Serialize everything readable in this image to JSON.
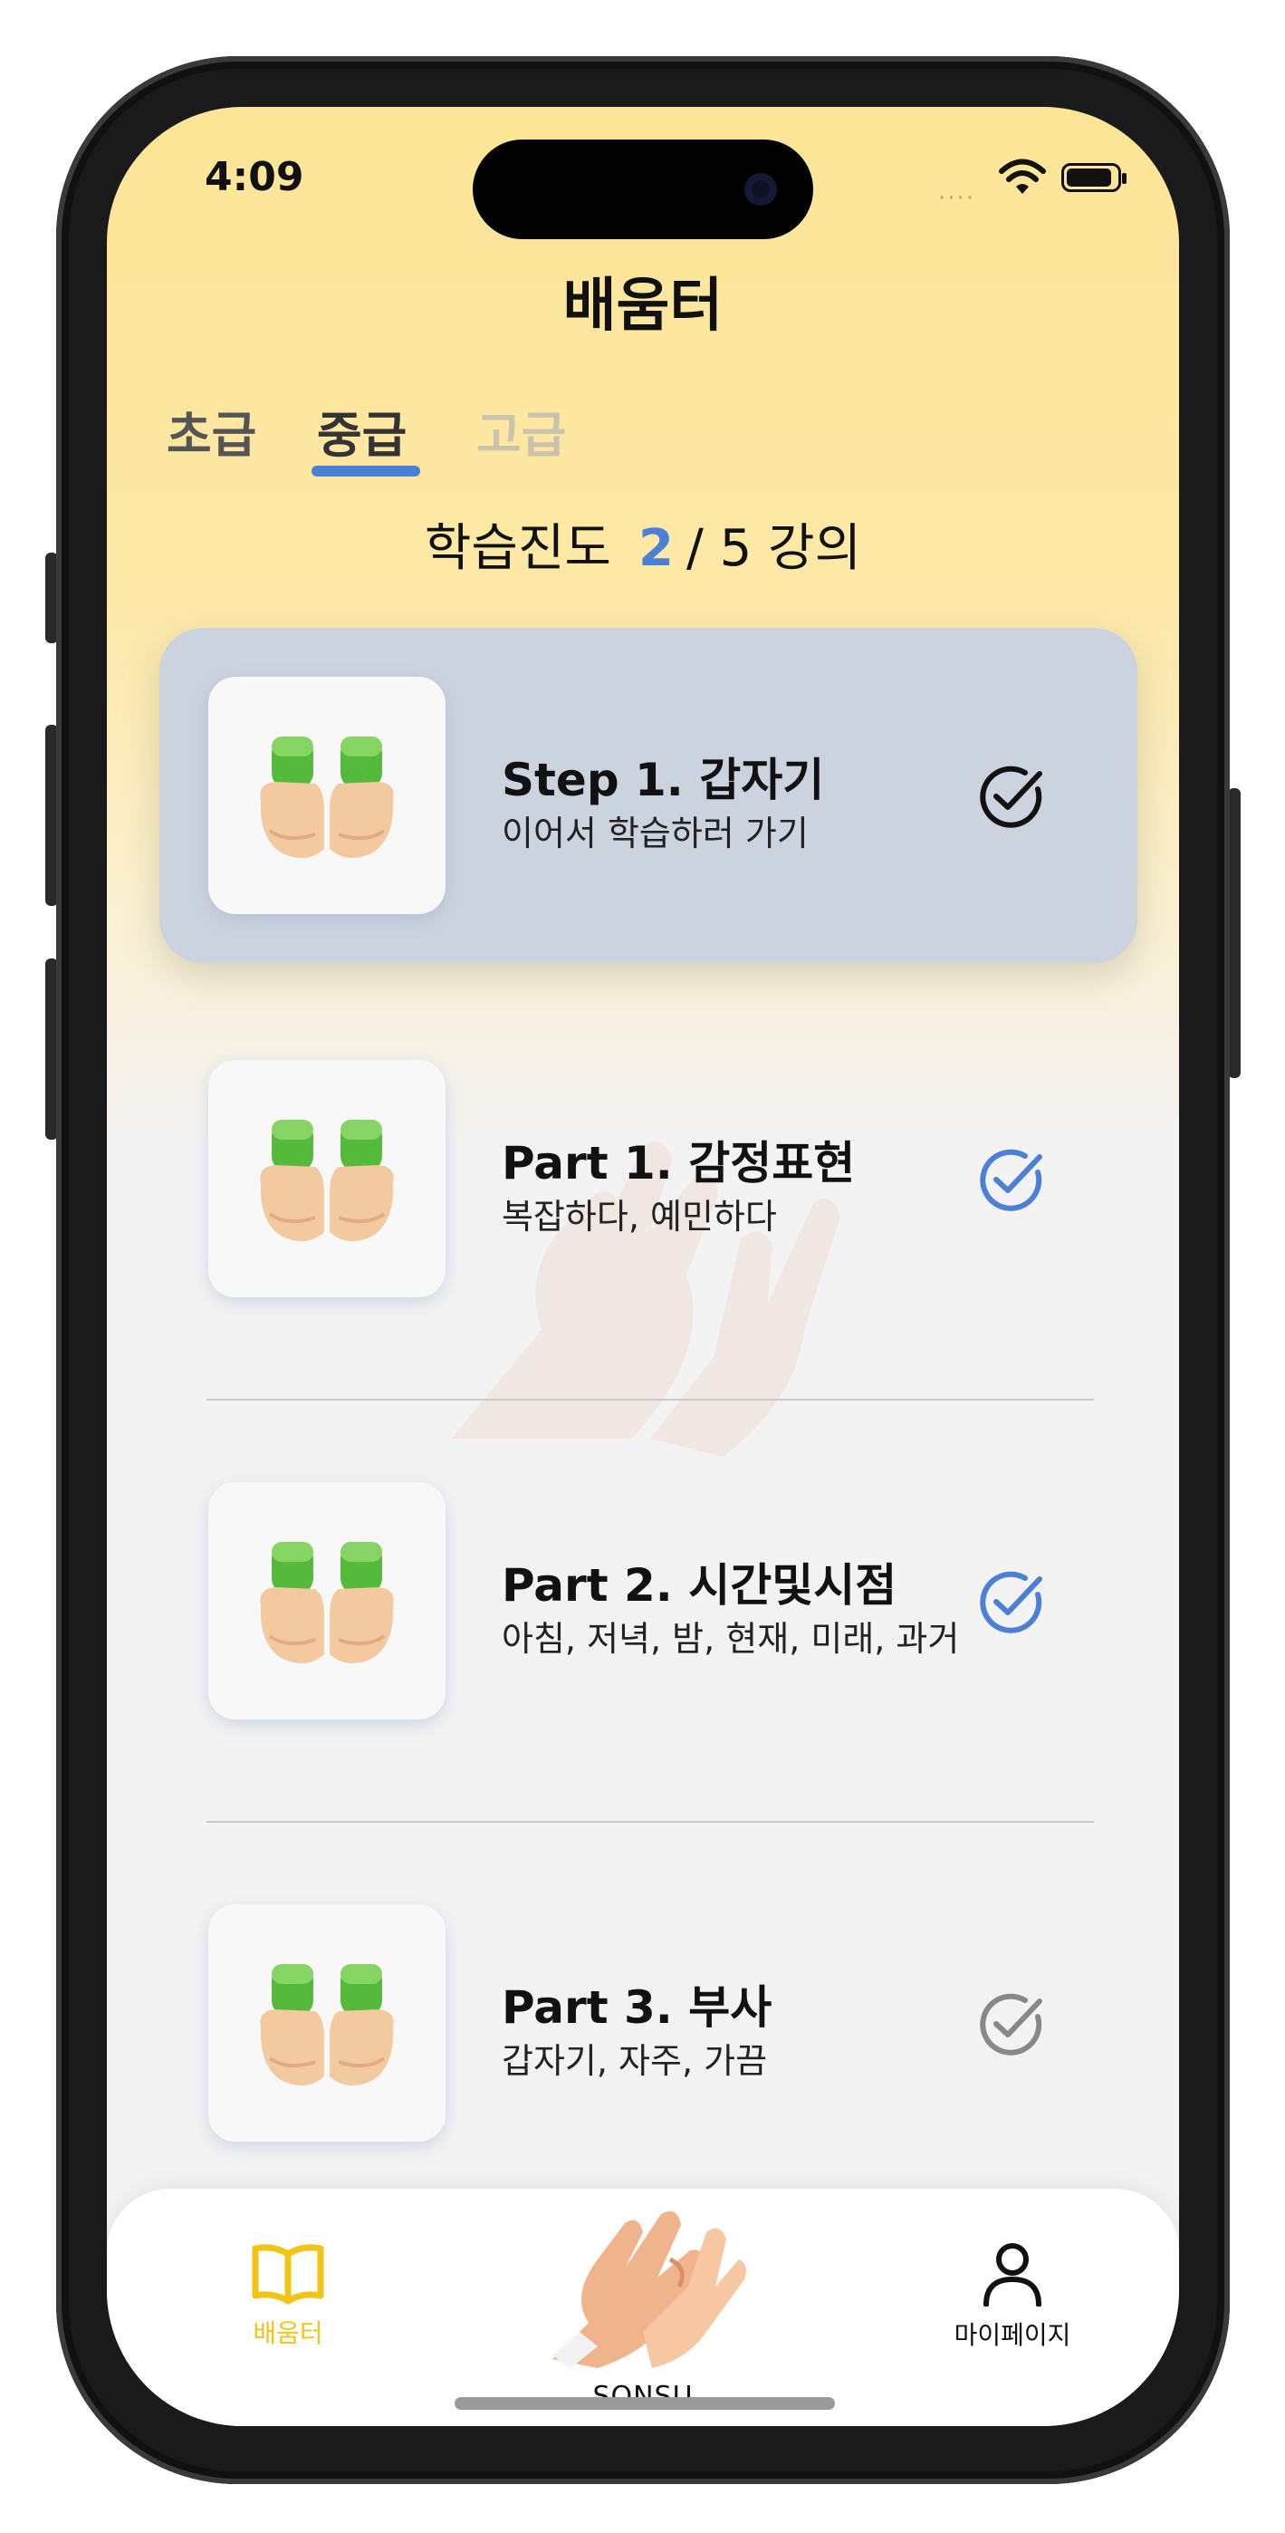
{
  "status_bar": {
    "time": "4:09",
    "signal": "····"
  },
  "header": {
    "title": "배움터"
  },
  "tabs": [
    {
      "label": "초급",
      "state": "normal"
    },
    {
      "label": "중급",
      "state": "selected"
    },
    {
      "label": "고급",
      "state": "disabled"
    }
  ],
  "progress": {
    "label": "학습진도",
    "current": "2",
    "separator": "/",
    "total_text": "5 강의"
  },
  "lessons": [
    {
      "title": "Step 1. 갑자기",
      "subtitle": "이어서 학습하러 가기",
      "thumbnail_icon": "open-hands-icon",
      "check_state": "current",
      "check_color": "#111111"
    },
    {
      "title": "Part 1. 감정표현",
      "subtitle": "복잡하다, 예민하다",
      "thumbnail_icon": "open-hands-icon",
      "check_state": "completed",
      "check_color": "#4c7fd6"
    },
    {
      "title": "Part 2. 시간및시점",
      "subtitle": "아침, 저녁, 밤, 현재, 미래, 과거",
      "thumbnail_icon": "open-hands-icon",
      "check_state": "completed",
      "check_color": "#4c7fd6"
    },
    {
      "title": "Part 3. 부사",
      "subtitle": "갑자기, 자주, 가끔",
      "thumbnail_icon": "open-hands-icon",
      "check_state": "incomplete",
      "check_color": "#888888"
    }
  ],
  "bottom_nav": [
    {
      "label": "배움터",
      "icon": "book-icon",
      "active": true
    },
    {
      "label": "SONSU",
      "icon": "hands-logo-icon",
      "active": false
    },
    {
      "label": "마이페이지",
      "icon": "person-icon",
      "active": false
    }
  ],
  "colors": {
    "accent": "#4c7fd6",
    "nav_active": "#f2c418",
    "active_card": "#cbd3de",
    "header_bg": "#fde597"
  }
}
